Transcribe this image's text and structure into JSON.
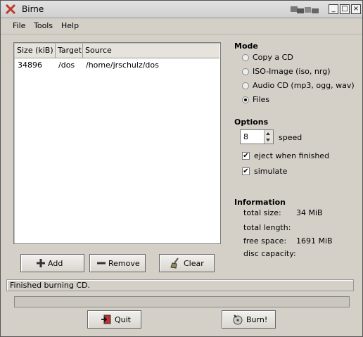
{
  "window": {
    "title": "Birne",
    "controls": {
      "minimize": "_",
      "maximize": "□",
      "close": "×"
    }
  },
  "menu": {
    "file": "File",
    "tools": "Tools",
    "help": "Help"
  },
  "file_list": {
    "columns": [
      "Size (kiB)",
      "Target",
      "Source"
    ],
    "rows": [
      {
        "size": "34896",
        "target": "/dos",
        "source": "/home/jrschulz/dos"
      }
    ]
  },
  "buttons": {
    "add": "Add",
    "remove": "Remove",
    "clear": "Clear",
    "quit": "Quit",
    "burn": "Burn!"
  },
  "mode": {
    "heading": "Mode",
    "options": [
      "Copy a CD",
      "ISO-Image (iso, nrg)",
      "Audio CD (mp3, ogg, wav)",
      "Files"
    ],
    "selected": "Files"
  },
  "options": {
    "heading": "Options",
    "speed_value": "8",
    "speed_label": "speed",
    "eject_label": "eject when finished",
    "eject_checked": true,
    "simulate_label": "simulate",
    "simulate_checked": true
  },
  "information": {
    "heading": "Information",
    "total_size_label": "total size:",
    "total_size_value": "34 MiB",
    "total_length_label": "total length:",
    "total_length_value": "",
    "free_space_label": "free space:",
    "free_space_value": "1691 MiB",
    "disc_capacity_label": "disc capacity:",
    "disc_capacity_value": ""
  },
  "status": {
    "text": "Finished burning CD.",
    "progress": 0
  },
  "icons": {
    "app": "birne-x-icon",
    "add": "plus-icon",
    "remove": "minus-icon",
    "clear": "broom-icon",
    "quit": "exit-door-icon",
    "burn": "burn-disc-icon",
    "pager": "desktop-pager-icon"
  }
}
